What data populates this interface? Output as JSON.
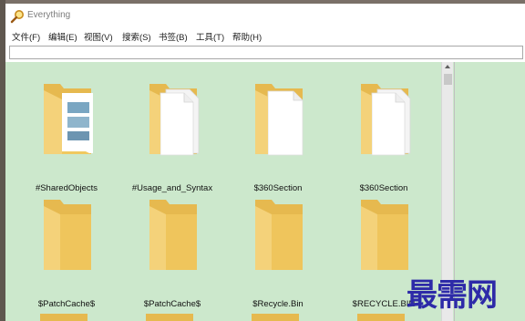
{
  "window": {
    "title": "Everything"
  },
  "menu": [
    {
      "label": "文件(F)"
    },
    {
      "label": "编辑(E)"
    },
    {
      "label": "视图(V)"
    },
    {
      "label": "搜索(S)"
    },
    {
      "label": "书签(B)"
    },
    {
      "label": "工具(T)"
    },
    {
      "label": "帮助(H)"
    }
  ],
  "search": {
    "value": ""
  },
  "items": [
    {
      "name": "#SharedObjects",
      "icon": "folder-with-images-icon"
    },
    {
      "name": "#Usage_and_Syntax",
      "icon": "folder-with-documents-icon"
    },
    {
      "name": "$360Section",
      "icon": "folder-with-document-icon"
    },
    {
      "name": "$360Section",
      "icon": "folder-with-documents-icon"
    },
    {
      "name": "$PatchCache$",
      "icon": "folder-icon"
    },
    {
      "name": "$PatchCache$",
      "icon": "folder-icon"
    },
    {
      "name": "$Recycle.Bin",
      "icon": "folder-icon"
    },
    {
      "name": "$RECYCLE.BIN",
      "icon": "folder-icon"
    }
  ],
  "watermark": "最需网",
  "colors": {
    "content_bg": "#cce8cc",
    "folder": "#f4d27a",
    "folder_dark": "#e6b94f"
  }
}
